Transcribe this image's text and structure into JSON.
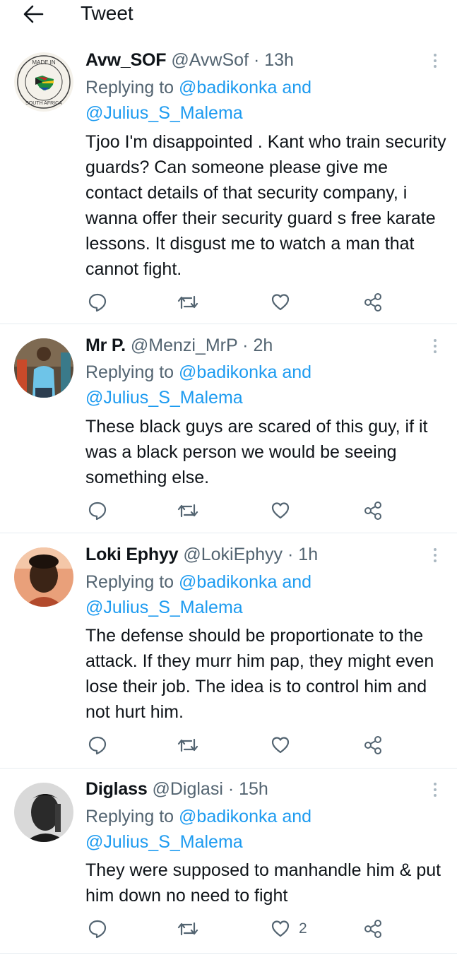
{
  "header": {
    "title": "Tweet"
  },
  "tweets": [
    {
      "name": "Avw_SOF",
      "handle": "@AvwSof",
      "sep": "·",
      "time": "13h",
      "replying_prefix": "Replying to ",
      "mention1": "@badikonka",
      "and_word": " and",
      "mention2": "@Julius_S_Malema",
      "text": "Tjoo I'm disappointed . Kant who train security guards? Can someone please give me contact details of that security company, i wanna offer their security guard s free karate lessons. It disgust me to watch a man that cannot fight.",
      "avatar_badge_top": "MADE IN",
      "avatar_badge_bottom": "SOUTH AFRICA",
      "likes": ""
    },
    {
      "name": "Mr P.",
      "handle": "@Menzi_MrP",
      "sep": "·",
      "time": "2h",
      "replying_prefix": "Replying to ",
      "mention1": "@badikonka",
      "and_word": " and",
      "mention2": "@Julius_S_Malema",
      "text": "These black guys are scared of this guy, if it was a black person we would be seeing something else.",
      "likes": ""
    },
    {
      "name": "Loki Ephyy",
      "handle": "@LokiEphyy",
      "sep": "·",
      "time": "1h",
      "replying_prefix": "Replying to ",
      "mention1": "@badikonka",
      "and_word": " and",
      "mention2": "@Julius_S_Malema",
      "text": "The defense should be proportionate to the attack. If they murr him pap, they might even lose their job. The idea is to control him and not hurt him.",
      "likes": ""
    },
    {
      "name": "Diglass",
      "handle": "@Diglasi",
      "sep": "·",
      "time": "15h",
      "replying_prefix": "Replying to ",
      "mention1": "@badikonka",
      "and_word": " and",
      "mention2": "@Julius_S_Malema",
      "text": "They were supposed to manhandle him & put him down no need to fight",
      "likes": "2"
    }
  ],
  "icons": {
    "back": "arrow-left-icon",
    "more": "more-vertical-icon",
    "reply": "reply-icon",
    "retweet": "retweet-icon",
    "like": "heart-icon",
    "share": "share-icon"
  },
  "colors": {
    "text": "#0f1419",
    "secondary": "#536471",
    "link": "#1d9bf0",
    "divider": "#e6ecf0",
    "more_dots": "#aab8c2"
  }
}
